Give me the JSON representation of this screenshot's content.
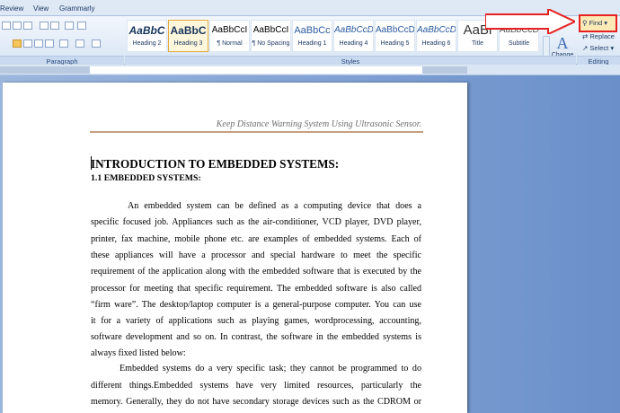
{
  "tabs": [
    "Review",
    "View",
    "Grammarly"
  ],
  "ribbon": {
    "groups": {
      "paragraph": "Paragraph",
      "styles": "Styles",
      "editing": "Editing"
    },
    "styles": [
      {
        "sample": "AaBbC",
        "name": "Heading 2"
      },
      {
        "sample": "AaBbC",
        "name": "Heading 3"
      },
      {
        "sample": "AaBbCcI",
        "name": "¶ Normal"
      },
      {
        "sample": "AaBbCcI",
        "name": "¶ No Spacing"
      },
      {
        "sample": "AaBbCc",
        "name": "Heading 1"
      },
      {
        "sample": "AaBbCcD",
        "name": "Heading 4"
      },
      {
        "sample": "AaBbCcD",
        "name": "Heading 5"
      },
      {
        "sample": "AaBbCcD",
        "name": "Heading 6"
      },
      {
        "sample": "AaBl",
        "name": "Title"
      },
      {
        "sample": "AaBbCcD",
        "name": "Subtitle"
      }
    ],
    "change_styles": "Change Styles",
    "editing": {
      "find": "Find",
      "replace": "Replace",
      "select": "Select"
    }
  },
  "document": {
    "header": "Keep Distance Warning System Using Ultrasonic Sensor.",
    "title": "INTRODUCTION TO EMBEDDED SYSTEMS:",
    "subtitle": "1.1 EMBEDDED SYSTEMS:",
    "lines": [
      "An embedded system can be defined as a computing device that does a",
      "specific focused job. Appliances such as the air-conditioner, VCD player, DVD player,",
      "printer, fax machine, mobile phone etc. are examples of embedded systems. Each of",
      "these appliances will have a processor and special hardware to meet the specific",
      "requirement of the application along with the embedded software that is executed by the",
      "processor for meeting that specific requirement. The embedded software is also called",
      "“firm ware”. The desktop/laptop computer is a general-purpose computer. You can use",
      "it for a variety of applications such as playing games, wordprocessing, accounting,",
      "software development and so on. In contrast, the software in the embedded systems is",
      "always fixed listed below:",
      "Embedded systems do a very specific task; they cannot be programmed to do",
      "different things.Embedded systems have very limited resources, particularly the",
      "memory. Generally, they do not have secondary storage devices such as the CDROM or"
    ]
  },
  "colors": {
    "highlight": "#e62020",
    "selected_style": "#e4a93c"
  }
}
